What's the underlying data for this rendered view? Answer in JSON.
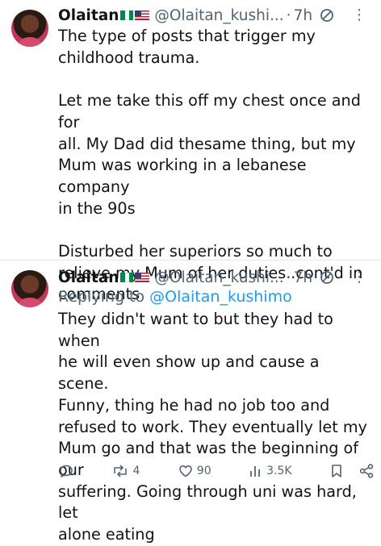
{
  "colors": {
    "text": "#0f1419",
    "muted": "#536471",
    "link": "#1d9bf0",
    "divider": "#e3e6e9"
  },
  "icons": [
    "avatar",
    "nigeria-flag-icon",
    "us-flag-icon",
    "gauge-icon",
    "more-icon",
    "reply-icon",
    "retweet-icon",
    "like-icon",
    "views-icon",
    "bookmark-icon",
    "share-icon"
  ],
  "tweet1": {
    "name": "Olaitan",
    "handle": "@Olaitan_kushi...",
    "dot": "·",
    "time": "7h",
    "more": "⋮",
    "text": "The type of posts that trigger my\nchildhood trauma.\n\nLet me take this off my chest once and for\nall. My Dad did thesame thing, but my\nMum was working in a  lebanese company\nin the 90s\n\nDisturbed her superiors so much to\nrelieve my Mum of her duties..cont'd in\ncomments"
  },
  "tweet2": {
    "name": "Olaitan",
    "handle": "@Olaitan_kushi...",
    "dot": "·",
    "time": "7h",
    "more": "⋮",
    "replying_prefix": "Replying to ",
    "replying_handle": "@Olaitan_kushimo",
    "text": "They didn't want to but they had to when\nhe will even show up and cause a scene.\nFunny, thing he had no job too and\nrefused to work. They eventually let my\nMum go and that was the beginning of our\nsuffering. Going through  uni was hard, let\nalone eating",
    "actions": {
      "retweets": "4",
      "likes": "90",
      "views": "3.5K"
    }
  }
}
